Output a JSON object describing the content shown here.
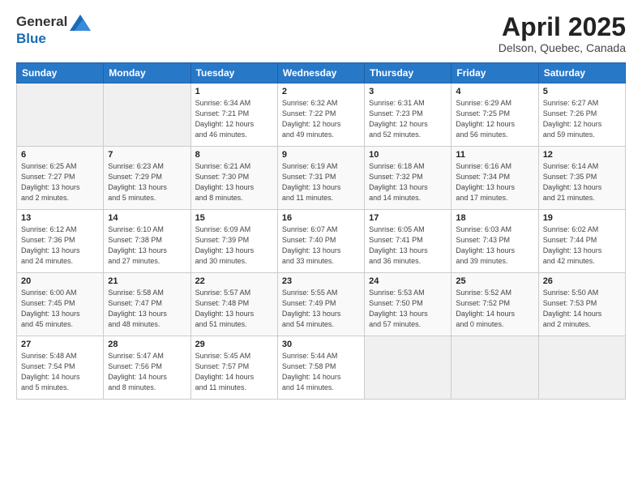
{
  "header": {
    "logo_general": "General",
    "logo_blue": "Blue",
    "month_title": "April 2025",
    "location": "Delson, Quebec, Canada"
  },
  "weekdays": [
    "Sunday",
    "Monday",
    "Tuesday",
    "Wednesday",
    "Thursday",
    "Friday",
    "Saturday"
  ],
  "weeks": [
    [
      {
        "day": "",
        "detail": ""
      },
      {
        "day": "",
        "detail": ""
      },
      {
        "day": "1",
        "detail": "Sunrise: 6:34 AM\nSunset: 7:21 PM\nDaylight: 12 hours\nand 46 minutes."
      },
      {
        "day": "2",
        "detail": "Sunrise: 6:32 AM\nSunset: 7:22 PM\nDaylight: 12 hours\nand 49 minutes."
      },
      {
        "day": "3",
        "detail": "Sunrise: 6:31 AM\nSunset: 7:23 PM\nDaylight: 12 hours\nand 52 minutes."
      },
      {
        "day": "4",
        "detail": "Sunrise: 6:29 AM\nSunset: 7:25 PM\nDaylight: 12 hours\nand 56 minutes."
      },
      {
        "day": "5",
        "detail": "Sunrise: 6:27 AM\nSunset: 7:26 PM\nDaylight: 12 hours\nand 59 minutes."
      }
    ],
    [
      {
        "day": "6",
        "detail": "Sunrise: 6:25 AM\nSunset: 7:27 PM\nDaylight: 13 hours\nand 2 minutes."
      },
      {
        "day": "7",
        "detail": "Sunrise: 6:23 AM\nSunset: 7:29 PM\nDaylight: 13 hours\nand 5 minutes."
      },
      {
        "day": "8",
        "detail": "Sunrise: 6:21 AM\nSunset: 7:30 PM\nDaylight: 13 hours\nand 8 minutes."
      },
      {
        "day": "9",
        "detail": "Sunrise: 6:19 AM\nSunset: 7:31 PM\nDaylight: 13 hours\nand 11 minutes."
      },
      {
        "day": "10",
        "detail": "Sunrise: 6:18 AM\nSunset: 7:32 PM\nDaylight: 13 hours\nand 14 minutes."
      },
      {
        "day": "11",
        "detail": "Sunrise: 6:16 AM\nSunset: 7:34 PM\nDaylight: 13 hours\nand 17 minutes."
      },
      {
        "day": "12",
        "detail": "Sunrise: 6:14 AM\nSunset: 7:35 PM\nDaylight: 13 hours\nand 21 minutes."
      }
    ],
    [
      {
        "day": "13",
        "detail": "Sunrise: 6:12 AM\nSunset: 7:36 PM\nDaylight: 13 hours\nand 24 minutes."
      },
      {
        "day": "14",
        "detail": "Sunrise: 6:10 AM\nSunset: 7:38 PM\nDaylight: 13 hours\nand 27 minutes."
      },
      {
        "day": "15",
        "detail": "Sunrise: 6:09 AM\nSunset: 7:39 PM\nDaylight: 13 hours\nand 30 minutes."
      },
      {
        "day": "16",
        "detail": "Sunrise: 6:07 AM\nSunset: 7:40 PM\nDaylight: 13 hours\nand 33 minutes."
      },
      {
        "day": "17",
        "detail": "Sunrise: 6:05 AM\nSunset: 7:41 PM\nDaylight: 13 hours\nand 36 minutes."
      },
      {
        "day": "18",
        "detail": "Sunrise: 6:03 AM\nSunset: 7:43 PM\nDaylight: 13 hours\nand 39 minutes."
      },
      {
        "day": "19",
        "detail": "Sunrise: 6:02 AM\nSunset: 7:44 PM\nDaylight: 13 hours\nand 42 minutes."
      }
    ],
    [
      {
        "day": "20",
        "detail": "Sunrise: 6:00 AM\nSunset: 7:45 PM\nDaylight: 13 hours\nand 45 minutes."
      },
      {
        "day": "21",
        "detail": "Sunrise: 5:58 AM\nSunset: 7:47 PM\nDaylight: 13 hours\nand 48 minutes."
      },
      {
        "day": "22",
        "detail": "Sunrise: 5:57 AM\nSunset: 7:48 PM\nDaylight: 13 hours\nand 51 minutes."
      },
      {
        "day": "23",
        "detail": "Sunrise: 5:55 AM\nSunset: 7:49 PM\nDaylight: 13 hours\nand 54 minutes."
      },
      {
        "day": "24",
        "detail": "Sunrise: 5:53 AM\nSunset: 7:50 PM\nDaylight: 13 hours\nand 57 minutes."
      },
      {
        "day": "25",
        "detail": "Sunrise: 5:52 AM\nSunset: 7:52 PM\nDaylight: 14 hours\nand 0 minutes."
      },
      {
        "day": "26",
        "detail": "Sunrise: 5:50 AM\nSunset: 7:53 PM\nDaylight: 14 hours\nand 2 minutes."
      }
    ],
    [
      {
        "day": "27",
        "detail": "Sunrise: 5:48 AM\nSunset: 7:54 PM\nDaylight: 14 hours\nand 5 minutes."
      },
      {
        "day": "28",
        "detail": "Sunrise: 5:47 AM\nSunset: 7:56 PM\nDaylight: 14 hours\nand 8 minutes."
      },
      {
        "day": "29",
        "detail": "Sunrise: 5:45 AM\nSunset: 7:57 PM\nDaylight: 14 hours\nand 11 minutes."
      },
      {
        "day": "30",
        "detail": "Sunrise: 5:44 AM\nSunset: 7:58 PM\nDaylight: 14 hours\nand 14 minutes."
      },
      {
        "day": "",
        "detail": ""
      },
      {
        "day": "",
        "detail": ""
      },
      {
        "day": "",
        "detail": ""
      }
    ]
  ]
}
